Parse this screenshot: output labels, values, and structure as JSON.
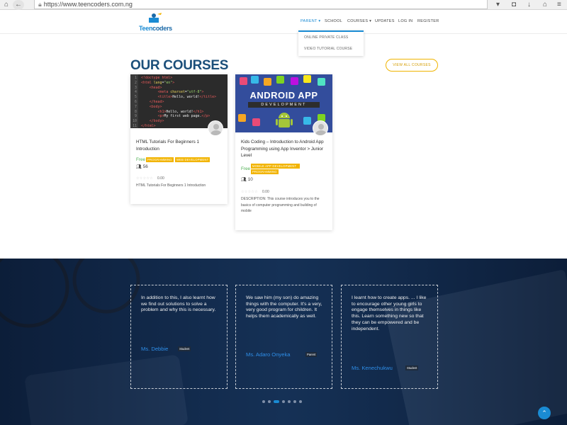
{
  "browser": {
    "url": "https://www.teencoders.com.ng"
  },
  "header": {
    "logo_text_teen": "Teen",
    "logo_text_coders": "coders",
    "menu": [
      {
        "label": "PARENT",
        "active": true,
        "has_caret": true
      },
      {
        "label": "SCHOOL",
        "active": false
      },
      {
        "label": "COURSES",
        "active": false,
        "has_caret": true
      },
      {
        "label": "UPDATES",
        "active": false
      },
      {
        "label": "LOG IN",
        "active": false
      },
      {
        "label": "REGISTER",
        "active": false
      }
    ],
    "dropdown": [
      "ONLINE PRIVATE CLASS",
      "VIDEO TUTORIAL COURSE"
    ]
  },
  "courses": {
    "title": "OUR COURSES",
    "view_all": "VIEW ALL COURSES",
    "items": [
      {
        "title": "HTML Tutorials For Beginners 1 Introduction",
        "price": "Free",
        "tags": [
          "PROGRAMMING",
          "WEB DEVELOPMENT"
        ],
        "students": "56",
        "stars": "☆☆☆☆☆",
        "rating": "0.00",
        "description": "HTML Tutorials For Beginners 1 Introduction",
        "code_lines": [
          "1",
          "2",
          "3",
          "4",
          "5",
          "6",
          "7",
          "8",
          "9",
          "10",
          "11"
        ]
      },
      {
        "title": "Kids Coding – Introduction to Android App Programming using App Inventor > Junior Level",
        "price": "Free",
        "tags": [
          "MOBILE APP DEVELOPMENT",
          "PROGRAMMING"
        ],
        "students": "10",
        "stars": "☆☆☆☆☆",
        "rating": "0.00",
        "description": "DESCRIPTION: This course introduces you to the basics of computer programming and building of mobile",
        "banner_title": "ANDROID APP",
        "banner_sub": "DEVELOPMENT"
      }
    ]
  },
  "testimonials": [
    {
      "quote": "In addition to this, I also learnt how we find out solutions to solve a problem and why this is necessary.",
      "name": "Ms. Debbie",
      "role": "Student"
    },
    {
      "quote": "We saw him (my son) do amazing things with the computer. It's a very, very good program for children. It helps them academically as well.",
      "name": "Ms. Adaro Onyeka",
      "role": "Parent"
    },
    {
      "quote": "I learnt how to create apps. ... I like to encourage other young girls to engage themselves in things like this. Learn something new so that they can be empowered and be independent.",
      "name": "Ms. Kenechukwu",
      "role": "Student"
    }
  ],
  "carousel": {
    "dots": 7,
    "active_index": 2
  },
  "colors": {
    "accent": "#1a8bd3",
    "tag": "#f2b400",
    "title": "#1b4f7a",
    "testimonial_bg": "#0f2a4e"
  }
}
